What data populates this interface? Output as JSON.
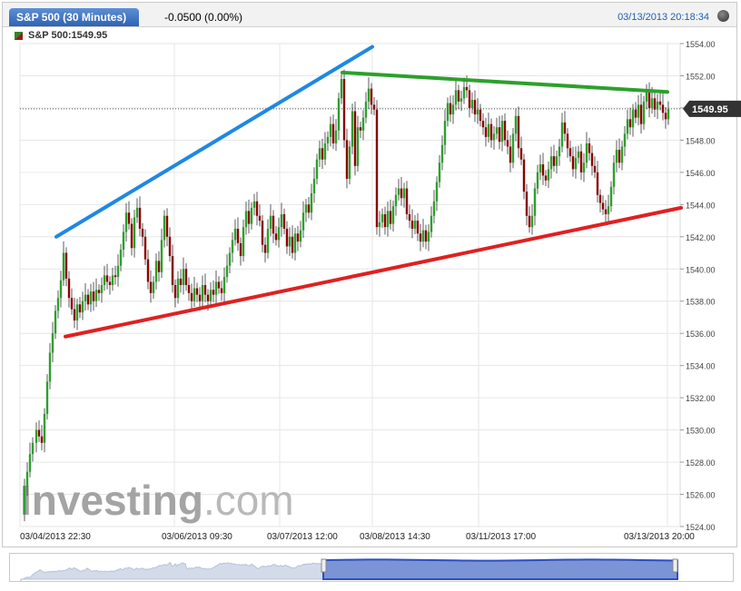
{
  "header": {
    "tab_label": "S&P 500 (30 Minutes)",
    "change": "-0.0500 (0.00%)",
    "datetime": "03/13/2013 20:18:34"
  },
  "legend": {
    "label": "S&P 500:1549.95"
  },
  "watermark": {
    "brand_main": "Investing",
    "brand_suffix": ".com"
  },
  "price_marker": {
    "label": "1549.95"
  },
  "colors": {
    "up": "#2ca02c",
    "down": "#8b0000",
    "trend_blue": "#1e88e5",
    "trend_green": "#2ca02c",
    "trend_red": "#e02020",
    "tab": "#3a70c2",
    "navigator_fill": "#7b94d6"
  },
  "chart_data": {
    "type": "candlestick",
    "title": "S&P 500 (30 Minutes)",
    "ylim": [
      1524,
      1554
    ],
    "y_ticks": [
      "1524.00",
      "1526.00",
      "1528.00",
      "1530.00",
      "1532.00",
      "1534.00",
      "1536.00",
      "1538.00",
      "1540.00",
      "1542.00",
      "1544.00",
      "1546.00",
      "1548.00",
      "1550.00",
      "1552.00",
      "1554.00"
    ],
    "x_tick_labels": [
      "03/04/2013 22:30",
      "03/06/2013 09:30",
      "03/07/2013 12:00",
      "03/08/2013 14:30",
      "03/11/2013 17:00",
      "03/13/2013 20:00"
    ],
    "last_price": 1549.95,
    "price_path": [
      [
        0,
        1524.8
      ],
      [
        3,
        1526.5
      ],
      [
        6,
        1527.4
      ],
      [
        9,
        1528.5
      ],
      [
        12,
        1529.2
      ],
      [
        16,
        1530.0
      ],
      [
        19,
        1529.6
      ],
      [
        22,
        1529.2
      ],
      [
        25,
        1531.0
      ],
      [
        28,
        1533.0
      ],
      [
        31,
        1534.8
      ],
      [
        34,
        1536.0
      ],
      [
        37,
        1537.4
      ],
      [
        40,
        1538.2
      ],
      [
        43,
        1539.3
      ],
      [
        46,
        1541.0
      ],
      [
        49,
        1539.4
      ],
      [
        52,
        1538.2
      ],
      [
        55,
        1537.5
      ],
      [
        58,
        1536.8
      ],
      [
        61,
        1537.8
      ],
      [
        64,
        1537.3
      ],
      [
        67,
        1538.0
      ],
      [
        70,
        1538.4
      ],
      [
        73,
        1537.8
      ],
      [
        76,
        1538.6
      ],
      [
        79,
        1538.0
      ],
      [
        82,
        1538.7
      ],
      [
        85,
        1538.5
      ],
      [
        88,
        1539.0
      ],
      [
        91,
        1539.6
      ],
      [
        94,
        1539.2
      ],
      [
        97,
        1539.0
      ],
      [
        100,
        1539.6
      ],
      [
        103,
        1539.5
      ],
      [
        106,
        1540.2
      ],
      [
        109,
        1541.2
      ],
      [
        112,
        1542.3
      ],
      [
        115,
        1543.5
      ],
      [
        118,
        1542.8
      ],
      [
        121,
        1541.3
      ],
      [
        124,
        1543.2
      ],
      [
        127,
        1543.8
      ],
      [
        130,
        1542.5
      ],
      [
        133,
        1542.0
      ],
      [
        136,
        1540.6
      ],
      [
        139,
        1539.2
      ],
      [
        142,
        1538.5
      ],
      [
        145,
        1539.2
      ],
      [
        148,
        1540.5
      ],
      [
        151,
        1539.8
      ],
      [
        154,
        1541.8
      ],
      [
        157,
        1543.3
      ],
      [
        160,
        1542.0
      ],
      [
        163,
        1540.8
      ],
      [
        166,
        1539.0
      ],
      [
        169,
        1538.2
      ],
      [
        172,
        1539.4
      ],
      [
        175,
        1539.0
      ],
      [
        178,
        1540.0
      ],
      [
        181,
        1539.0
      ],
      [
        184,
        1538.5
      ],
      [
        187,
        1538.0
      ],
      [
        190,
        1538.8
      ],
      [
        193,
        1538.4
      ],
      [
        196,
        1538.0
      ],
      [
        199,
        1539.0
      ],
      [
        202,
        1538.4
      ],
      [
        205,
        1538.0
      ],
      [
        208,
        1538.7
      ],
      [
        211,
        1538.4
      ],
      [
        214,
        1539.2
      ],
      [
        217,
        1538.8
      ],
      [
        220,
        1538.5
      ],
      [
        223,
        1539.5
      ],
      [
        226,
        1540.2
      ],
      [
        229,
        1541.0
      ],
      [
        232,
        1541.8
      ],
      [
        235,
        1542.5
      ],
      [
        238,
        1541.6
      ],
      [
        241,
        1540.8
      ],
      [
        244,
        1542.6
      ],
      [
        247,
        1543.6
      ],
      [
        250,
        1542.8
      ],
      [
        253,
        1543.8
      ],
      [
        256,
        1544.2
      ],
      [
        259,
        1543.3
      ],
      [
        262,
        1543.0
      ],
      [
        265,
        1541.5
      ],
      [
        268,
        1541.0
      ],
      [
        271,
        1542.5
      ],
      [
        274,
        1543.3
      ],
      [
        277,
        1542.2
      ],
      [
        280,
        1541.8
      ],
      [
        283,
        1542.6
      ],
      [
        286,
        1543.4
      ],
      [
        289,
        1542.5
      ],
      [
        292,
        1541.4
      ],
      [
        295,
        1542.0
      ],
      [
        298,
        1541.0
      ],
      [
        301,
        1542.2
      ],
      [
        304,
        1541.7
      ],
      [
        307,
        1542.4
      ],
      [
        310,
        1543.5
      ],
      [
        313,
        1544.0
      ],
      [
        316,
        1543.5
      ],
      [
        319,
        1544.7
      ],
      [
        322,
        1545.6
      ],
      [
        325,
        1546.8
      ],
      [
        328,
        1547.5
      ],
      [
        331,
        1546.8
      ],
      [
        334,
        1547.8
      ],
      [
        337,
        1548.2
      ],
      [
        340,
        1549.0
      ],
      [
        343,
        1547.8
      ],
      [
        346,
        1548.6
      ],
      [
        349,
        1550.6
      ],
      [
        352,
        1551.8
      ],
      [
        355,
        1548.0
      ],
      [
        358,
        1545.6
      ],
      [
        361,
        1547.6
      ],
      [
        364,
        1549.8
      ],
      [
        367,
        1546.4
      ],
      [
        370,
        1548.8
      ],
      [
        373,
        1548.6
      ],
      [
        376,
        1549.4
      ],
      [
        379,
        1550.4
      ],
      [
        382,
        1551.2
      ],
      [
        385,
        1550.2
      ],
      [
        388,
        1549.9
      ],
      [
        391,
        1542.6
      ],
      [
        394,
        1542.9
      ],
      [
        397,
        1543.4
      ],
      [
        400,
        1542.6
      ],
      [
        403,
        1543.6
      ],
      [
        406,
        1542.8
      ],
      [
        409,
        1543.9
      ],
      [
        412,
        1544.6
      ],
      [
        415,
        1545.0
      ],
      [
        418,
        1544.4
      ],
      [
        421,
        1545.0
      ],
      [
        424,
        1543.4
      ],
      [
        427,
        1543.0
      ],
      [
        430,
        1542.5
      ],
      [
        433,
        1543.0
      ],
      [
        436,
        1542.2
      ],
      [
        439,
        1541.7
      ],
      [
        442,
        1542.4
      ],
      [
        445,
        1541.7
      ],
      [
        448,
        1542.3
      ],
      [
        451,
        1543.3
      ],
      [
        454,
        1544.2
      ],
      [
        457,
        1545.4
      ],
      [
        460,
        1546.6
      ],
      [
        463,
        1547.7
      ],
      [
        466,
        1549.2
      ],
      [
        469,
        1550.3
      ],
      [
        472,
        1549.6
      ],
      [
        475,
        1550.2
      ],
      [
        478,
        1551.1
      ],
      [
        481,
        1550.4
      ],
      [
        484,
        1550.6
      ],
      [
        487,
        1551.3
      ],
      [
        490,
        1551.1
      ],
      [
        493,
        1550.0
      ],
      [
        496,
        1550.5
      ],
      [
        499,
        1549.6
      ],
      [
        502,
        1549.9
      ],
      [
        505,
        1549.2
      ],
      [
        508,
        1548.8
      ],
      [
        511,
        1548.2
      ],
      [
        514,
        1549.0
      ],
      [
        517,
        1548.0
      ],
      [
        520,
        1548.4
      ],
      [
        523,
        1548.8
      ],
      [
        526,
        1547.9
      ],
      [
        529,
        1549.2
      ],
      [
        532,
        1548.0
      ],
      [
        535,
        1547.6
      ],
      [
        538,
        1546.6
      ],
      [
        541,
        1548.4
      ],
      [
        544,
        1549.5
      ],
      [
        547,
        1547.5
      ],
      [
        550,
        1546.8
      ],
      [
        553,
        1544.8
      ],
      [
        556,
        1543.3
      ],
      [
        559,
        1542.6
      ],
      [
        562,
        1543.3
      ],
      [
        565,
        1545.0
      ],
      [
        568,
        1546.0
      ],
      [
        571,
        1546.5
      ],
      [
        574,
        1545.8
      ],
      [
        577,
        1545.5
      ],
      [
        580,
        1546.2
      ],
      [
        583,
        1547.0
      ],
      [
        586,
        1546.4
      ],
      [
        589,
        1547.0
      ],
      [
        592,
        1547.6
      ],
      [
        595,
        1549.1
      ],
      [
        598,
        1548.4
      ],
      [
        601,
        1547.5
      ],
      [
        604,
        1547.0
      ],
      [
        607,
        1546.2
      ],
      [
        610,
        1546.9
      ],
      [
        613,
        1547.3
      ],
      [
        616,
        1546.0
      ],
      [
        619,
        1546.6
      ],
      [
        622,
        1547.8
      ],
      [
        625,
        1547.2
      ],
      [
        628,
        1546.4
      ],
      [
        631,
        1546.0
      ],
      [
        634,
        1544.6
      ],
      [
        637,
        1544.1
      ],
      [
        640,
        1543.7
      ],
      [
        643,
        1543.4
      ],
      [
        646,
        1543.9
      ],
      [
        649,
        1545.1
      ],
      [
        652,
        1546.6
      ],
      [
        655,
        1547.4
      ],
      [
        658,
        1546.6
      ],
      [
        661,
        1547.6
      ],
      [
        664,
        1548.4
      ],
      [
        667,
        1549.3
      ],
      [
        670,
        1548.8
      ],
      [
        673,
        1549.9
      ],
      [
        676,
        1549.4
      ],
      [
        679,
        1550.2
      ],
      [
        682,
        1549.0
      ],
      [
        685,
        1550.4
      ],
      [
        688,
        1551.0
      ],
      [
        691,
        1550.0
      ],
      [
        694,
        1550.6
      ],
      [
        697,
        1549.9
      ],
      [
        700,
        1550.4
      ],
      [
        703,
        1550.2
      ],
      [
        706,
        1549.7
      ],
      [
        709,
        1549.3
      ],
      [
        712,
        1549.95
      ]
    ],
    "trendlines": [
      {
        "color": "blue",
        "from": [
          "03/04/2013 22:30",
          1542.0
        ],
        "to": [
          "03/08/2013 14:30",
          1553.8
        ]
      },
      {
        "color": "green",
        "from": [
          "03/08/2013 14:30",
          1552.2
        ],
        "to": [
          "03/13/2013 20:00",
          1551.0
        ]
      },
      {
        "color": "red",
        "from": [
          "03/04/2013 22:30",
          1535.8
        ],
        "to": [
          "03/13/2013 20:00",
          1543.8
        ]
      }
    ],
    "grid": true
  }
}
